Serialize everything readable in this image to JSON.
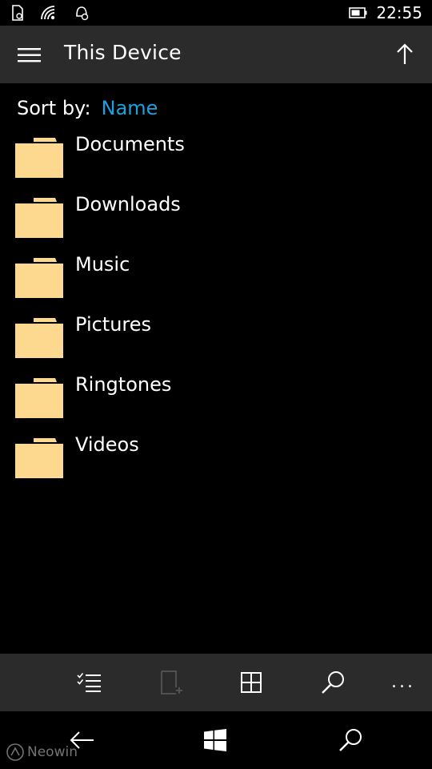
{
  "status_bar": {
    "time": "22:55",
    "icons": [
      "sim-icon",
      "wifi-icon",
      "notification-icon",
      "battery-icon"
    ]
  },
  "header": {
    "title": "This Device",
    "menu_icon": "hamburger-icon",
    "up_icon": "up-arrow-icon"
  },
  "sort": {
    "label": "Sort by:",
    "value": "Name"
  },
  "folders": [
    {
      "name": "Documents"
    },
    {
      "name": "Downloads"
    },
    {
      "name": "Music"
    },
    {
      "name": "Pictures"
    },
    {
      "name": "Ringtones"
    },
    {
      "name": "Videos"
    }
  ],
  "app_bar": {
    "buttons": [
      "select-icon",
      "new-folder-icon",
      "view-icon",
      "search-icon",
      "more-icon"
    ],
    "more": "..."
  },
  "nav_bar": {
    "buttons": [
      "back-icon",
      "windows-icon",
      "search-icon"
    ]
  },
  "watermark": "Neowin",
  "colors": {
    "accent": "#1ba1e2",
    "folder": "#fcd98f",
    "bar": "#2b2b2b",
    "background": "#000000"
  }
}
